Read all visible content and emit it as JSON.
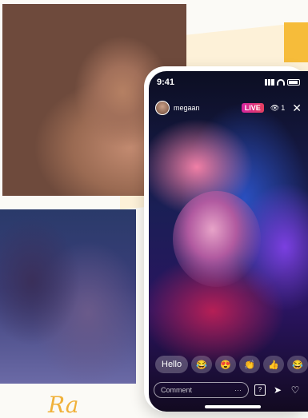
{
  "phone": {
    "status_time": "9:41",
    "username": "megaan",
    "live_label": "LIVE",
    "viewer_count": "1",
    "comment_placeholder": "Comment",
    "more_label": "···",
    "hello_label": "Hello",
    "reactions": [
      "😂",
      "😍",
      "👏",
      "👍",
      "😂"
    ]
  },
  "collage": {
    "script_text": "Ra"
  },
  "colors": {
    "accent_yellow": "#f6bc3a",
    "live_gradient_start": "#d6249f",
    "live_gradient_end": "#e4405f"
  }
}
